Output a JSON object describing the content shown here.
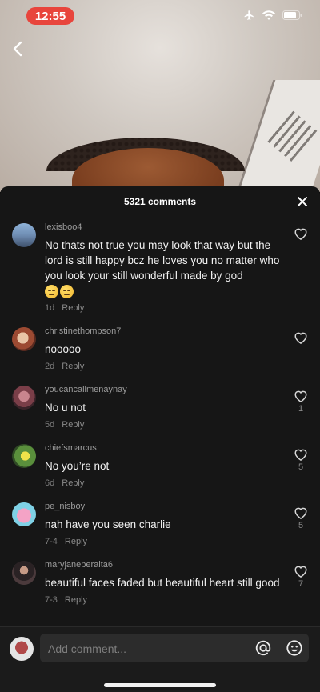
{
  "status": {
    "time": "12:55"
  },
  "sheet": {
    "title": "5321 comments"
  },
  "comments": [
    {
      "username": "lexisboo4",
      "text": "No thats not true you may look that way but the lord is still happy bcz he loves you no matter who you look your still wonderful made by god",
      "emoji_count": 2,
      "time": "1d",
      "reply": "Reply",
      "likes": ""
    },
    {
      "username": "christinethompson7",
      "text": "nooooo",
      "time": "2d",
      "reply": "Reply",
      "likes": ""
    },
    {
      "username": "youcancallmenaynay",
      "text": "No u not",
      "time": "5d",
      "reply": "Reply",
      "likes": "1"
    },
    {
      "username": "chiefsmarcus",
      "text": "No you’re not",
      "time": "6d",
      "reply": "Reply",
      "likes": "5"
    },
    {
      "username": "pe_nisboy",
      "text": "nah have you seen charlie",
      "time": "7-4",
      "reply": "Reply",
      "likes": "5"
    },
    {
      "username": "maryjaneperalta6",
      "text": "beautiful faces faded but beautiful heart still good",
      "time": "7-3",
      "reply": "Reply",
      "likes": "7"
    }
  ],
  "composer": {
    "placeholder": "Add comment..."
  },
  "colors": {
    "time_pill": "#e8453c",
    "sheet_bg": "#161616",
    "icon": "#e6e6e6"
  }
}
